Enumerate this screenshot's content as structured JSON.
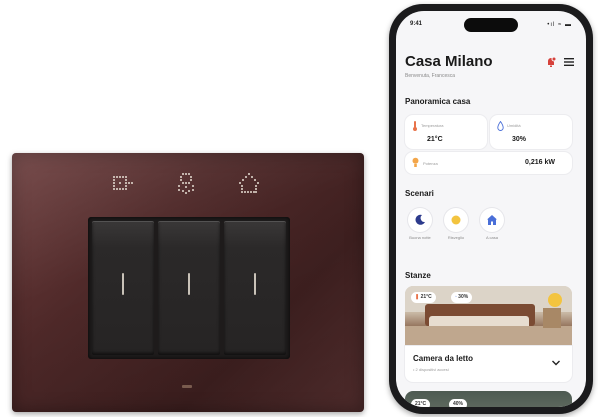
{
  "colors": {
    "plate": "#4f2929",
    "accent_red": "#d6413b",
    "accent_yellow": "#f3c43f",
    "accent_blue": "#4a6fd8"
  },
  "device": {
    "icons": [
      "switch-dots-icon",
      "person-dots-icon",
      "house-dots-icon"
    ]
  },
  "phone": {
    "status_time": "9:41",
    "status_icons": "•ıl ≈ ▬",
    "app": {
      "title": "Casa Milano",
      "subtitle": "Benvenuta, Francesca"
    },
    "overview": {
      "heading": "Panoramica casa",
      "stats": [
        {
          "label": "Temperatura",
          "value": "21°C",
          "icon": "thermometer-icon"
        },
        {
          "label": "Umidità",
          "value": "30%",
          "icon": "droplet-icon"
        },
        {
          "label": "Potenza",
          "value": "0,216 kW",
          "icon": "bulb-icon"
        }
      ]
    },
    "scenes": {
      "heading": "Scenari",
      "items": [
        {
          "label": "Buona notte",
          "icon": "moon-icon"
        },
        {
          "label": "Risveglio",
          "icon": "sun-icon"
        },
        {
          "label": "A casa",
          "icon": "home-icon"
        }
      ]
    },
    "rooms": {
      "heading": "Stanze",
      "items": [
        {
          "name": "Camera da letto",
          "temp": "21°C",
          "humidity": "30%",
          "detail": "• 2 dispositivi accesi"
        },
        {
          "temp": "21°C",
          "humidity": "40%"
        }
      ]
    }
  }
}
